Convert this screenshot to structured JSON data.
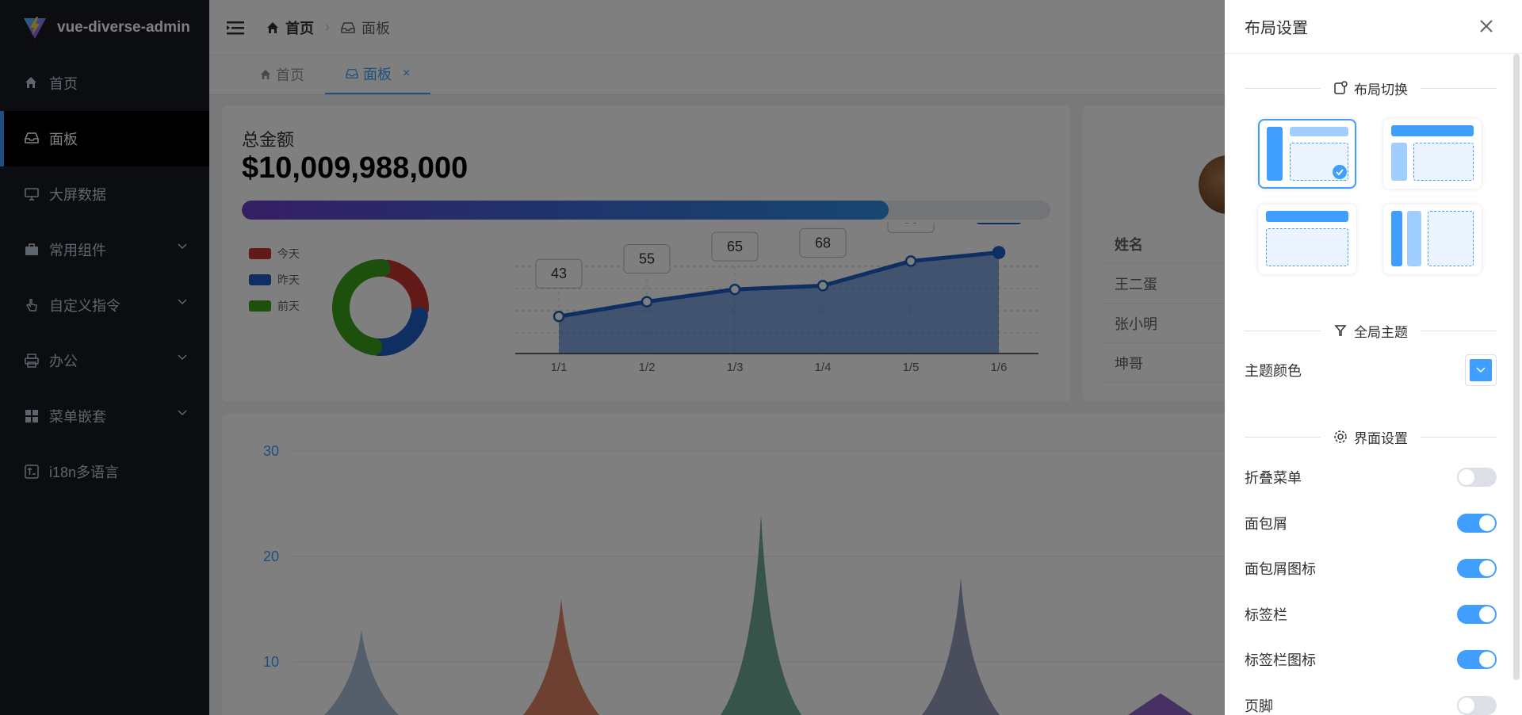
{
  "app": {
    "title": "vue-diverse-admin"
  },
  "sidebar": {
    "items": [
      {
        "label": "首页",
        "icon": "home-icon",
        "active": false,
        "has_arrow": false
      },
      {
        "label": "面板",
        "icon": "inbox-icon",
        "active": true,
        "has_arrow": false
      },
      {
        "label": "大屏数据",
        "icon": "monitor-icon",
        "active": false,
        "has_arrow": false
      },
      {
        "label": "常用组件",
        "icon": "briefcase-icon",
        "active": false,
        "has_arrow": true
      },
      {
        "label": "自定义指令",
        "icon": "pointer-icon",
        "active": false,
        "has_arrow": true
      },
      {
        "label": "办公",
        "icon": "printer-icon",
        "active": false,
        "has_arrow": true
      },
      {
        "label": "菜单嵌套",
        "icon": "grid-icon",
        "active": false,
        "has_arrow": true
      },
      {
        "label": "i18n多语言",
        "icon": "translate-icon",
        "active": false,
        "has_arrow": false
      }
    ]
  },
  "header": {
    "breadcrumb": [
      "首页",
      "面板"
    ]
  },
  "tabs": [
    {
      "label": "首页",
      "active": false,
      "closable": false
    },
    {
      "label": "面板",
      "active": true,
      "closable": true,
      "close_glyph": "×"
    }
  ],
  "dashboard": {
    "total_label": "总金额",
    "total_value": "$10,009,988,000",
    "progress": 0.8,
    "legend": [
      {
        "label": "今天",
        "color": "#c23531"
      },
      {
        "label": "昨天",
        "color": "#1e5dc4"
      },
      {
        "label": "前天",
        "color": "#3a9e1a"
      }
    ],
    "names_header": "姓名",
    "names": [
      "王二蛋",
      "张小明",
      "坤哥"
    ]
  },
  "chart_data": [
    {
      "type": "pie",
      "categories": [
        "今天",
        "昨天",
        "前天"
      ],
      "values": [
        25,
        25,
        50
      ],
      "colors": [
        "#c23531",
        "#1e5dc4",
        "#3a9e1a"
      ]
    },
    {
      "type": "area",
      "categories": [
        "1/1",
        "1/2",
        "1/3",
        "1/4",
        "1/5",
        "1/6"
      ],
      "values": [
        43,
        55,
        65,
        68,
        88,
        95
      ],
      "ylim": [
        0,
        100
      ],
      "grid": true,
      "color": "#1e5dc4"
    },
    {
      "type": "area",
      "ylim": [
        0,
        30
      ],
      "yticks": [
        10,
        20,
        30
      ],
      "values": [
        13,
        16,
        24,
        18,
        7
      ],
      "colors": [
        "#8fa7c9",
        "#d0562f",
        "#3b8c6e",
        "#6e7aa0",
        "#6a2bb3"
      ]
    }
  ],
  "drawer": {
    "title": "布局设置",
    "section_layout": "布局切换",
    "section_theme": "全局主题",
    "theme_color_label": "主题颜色",
    "theme_color": "#409eff",
    "section_ui": "界面设置",
    "settings": [
      {
        "label": "折叠菜单",
        "on": false
      },
      {
        "label": "面包屑",
        "on": true
      },
      {
        "label": "面包屑图标",
        "on": true
      },
      {
        "label": "标签栏",
        "on": true
      },
      {
        "label": "标签栏图标",
        "on": true
      },
      {
        "label": "页脚",
        "on": false
      }
    ],
    "selected_layout": 0
  }
}
